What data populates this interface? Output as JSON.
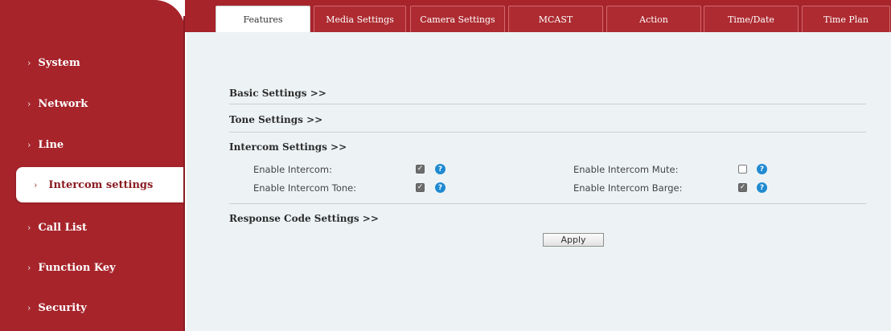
{
  "colors": {
    "brand": "#a7242b",
    "content_bg": "#edf3f5",
    "help_icon": "#1f8ad1"
  },
  "sidebar": {
    "items": [
      {
        "label": "System",
        "icon": "chevron-right-icon"
      },
      {
        "label": "Network",
        "icon": "chevron-right-icon"
      },
      {
        "label": "Line",
        "icon": "chevron-right-icon"
      },
      {
        "label": "Intercom settings",
        "icon": "chevron-right-icon",
        "active": true
      },
      {
        "label": "Call List",
        "icon": "chevron-right-icon"
      },
      {
        "label": "Function Key",
        "icon": "chevron-right-icon"
      },
      {
        "label": "Security",
        "icon": "chevron-right-icon"
      }
    ]
  },
  "tabs": [
    {
      "label": "Features",
      "active": true
    },
    {
      "label": "Media Settings"
    },
    {
      "label": "Camera Settings"
    },
    {
      "label": "MCAST"
    },
    {
      "label": "Action"
    },
    {
      "label": "Time/Date"
    },
    {
      "label": "Time Plan"
    }
  ],
  "sections": {
    "basic": "Basic Settings >>",
    "tone": "Tone Settings >>",
    "intercom": "Intercom Settings >>",
    "response": "Response Code Settings >>"
  },
  "intercom": {
    "enable_intercom": {
      "label": "Enable Intercom:",
      "checked": true
    },
    "enable_intercom_mute": {
      "label": "Enable Intercom Mute:",
      "checked": false
    },
    "enable_intercom_tone": {
      "label": "Enable Intercom Tone:",
      "checked": true
    },
    "enable_intercom_barge": {
      "label": "Enable Intercom Barge:",
      "checked": true
    },
    "help_glyph": "?"
  },
  "apply_label": "Apply",
  "chevron_glyph": "›",
  "check_glyph": "✓"
}
